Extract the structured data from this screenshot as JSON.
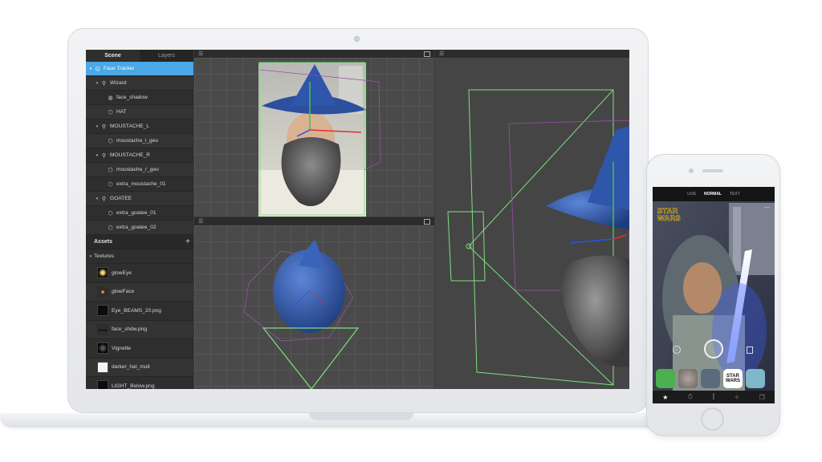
{
  "editor": {
    "tabs": [
      {
        "label": "Scene"
      },
      {
        "label": "Layers"
      }
    ],
    "scene_items": [
      {
        "label": "Face Tracker",
        "icon": "face-tracker-icon",
        "caret": "▾",
        "indent": 0,
        "selected": true
      },
      {
        "label": "Wizard",
        "icon": "null-object-icon",
        "caret": "▾",
        "indent": 1
      },
      {
        "label": "face_shadow",
        "icon": "mesh-icon",
        "caret": "",
        "indent": 2
      },
      {
        "label": "HAT",
        "icon": "cube-icon",
        "caret": "",
        "indent": 2
      },
      {
        "label": "MOUSTACHE_L",
        "icon": "null-object-icon",
        "caret": "▾",
        "indent": 1
      },
      {
        "label": "moustache_l_geo",
        "icon": "cube-icon",
        "caret": "",
        "indent": 2
      },
      {
        "label": "MOUSTACHE_R",
        "icon": "null-object-icon",
        "caret": "▾",
        "indent": 1
      },
      {
        "label": "moustache_r_geo",
        "icon": "cube-icon",
        "caret": "",
        "indent": 2
      },
      {
        "label": "extra_moustache_01",
        "icon": "cube-icon",
        "caret": "",
        "indent": 2
      },
      {
        "label": "GOATEE",
        "icon": "null-object-icon",
        "caret": "▾",
        "indent": 1
      },
      {
        "label": "extra_goatee_01",
        "icon": "cube-icon",
        "caret": "",
        "indent": 2
      },
      {
        "label": "extra_goatee_02",
        "icon": "cube-icon",
        "caret": "",
        "indent": 2
      }
    ],
    "assets": {
      "title": "Assets",
      "add_label": "+",
      "textures_label": "Textures",
      "textures": [
        {
          "label": "glowEye",
          "thumb": "glow"
        },
        {
          "label": "glowFace",
          "thumb": "dot"
        },
        {
          "label": "Eye_BEAMS_20.png",
          "thumb": "dark"
        },
        {
          "label": "face_shdw.png",
          "thumb": "shadow"
        },
        {
          "label": "Vignette",
          "thumb": "vignette"
        },
        {
          "label": "darker_hat_mult",
          "thumb": "white"
        },
        {
          "label": "LIGHT_Below.png",
          "thumb": "dark"
        }
      ]
    },
    "viewport_menu_glyph": "☰"
  },
  "phone": {
    "modes": [
      {
        "label": "LIVE"
      },
      {
        "label": "NORMAL",
        "active": true
      },
      {
        "label": "TEXT"
      }
    ],
    "brand_line1": "STAR",
    "brand_line2": "WARS",
    "lens_sw_line1": "STAR",
    "lens_sw_line2": "WARS",
    "more_glyph": "⋯",
    "check_glyph": "✓",
    "nav_icons": [
      "star-icon",
      "timer-icon",
      "effects-icon",
      "magic-icon",
      "gallery-icon"
    ],
    "nav_glyphs": [
      "★",
      "⏱",
      "⫿",
      "✧",
      "❐"
    ]
  },
  "colors": {
    "selection": "#4aa8e6",
    "wire_green": "#7ee07e",
    "wire_purple": "#9a4fa8",
    "hat_blue": "#2c4f9e"
  }
}
